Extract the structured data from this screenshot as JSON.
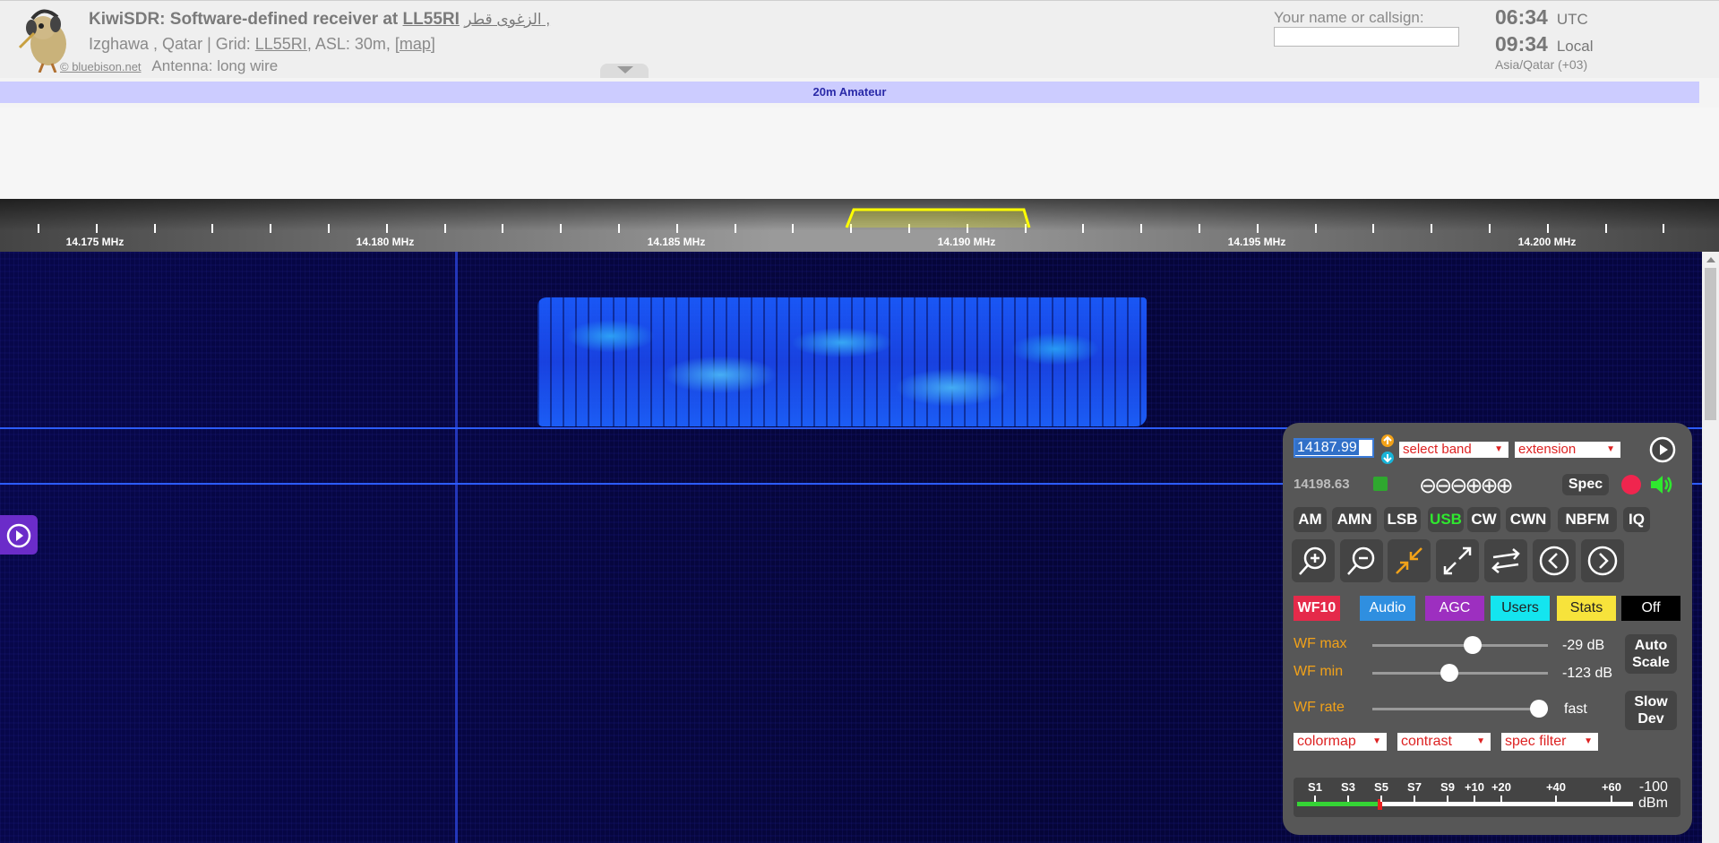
{
  "header": {
    "title_prefix": "KiwiSDR: Software-defined receiver at",
    "title_callsign": "LL55RI",
    "title_arabic": "الزغوى قطر ,",
    "location": "Izghawa , Qatar | Grid:",
    "grid": "LL55RI",
    "asl": ", ASL: 30m, [",
    "map_link": "map",
    "map_close": "]",
    "credit": "© bluebison.net",
    "antenna": "Antenna: long wire",
    "callsign_label": "Your name or callsign:",
    "callsign_value": "",
    "utc_time": "06:34",
    "utc_label": "UTC",
    "local_time": "09:34",
    "local_label": "Local",
    "timezone": "Asia/Qatar (+03)"
  },
  "band_bar": {
    "label": "20m Amateur"
  },
  "scale": {
    "labels": [
      "14.175 MHz",
      "14.180 MHz",
      "14.185 MHz",
      "14.190 MHz",
      "14.195 MHz",
      "14.200 MHz"
    ]
  },
  "panel": {
    "freq_value": "14187.99",
    "band_select": "select band",
    "extension_select": "extension",
    "freq_readout": "14198.63",
    "zoom_steps": "⊖⊖⊖⊕⊕⊕",
    "spec_label": "Spec",
    "modes": [
      "AM",
      "AMN",
      "LSB",
      "USB",
      "CW",
      "CWN",
      "NBFM",
      "IQ"
    ],
    "active_mode": "USB",
    "tabs": {
      "wf": "WF10",
      "audio": "Audio",
      "agc": "AGC",
      "users": "Users",
      "stats": "Stats",
      "off": "Off"
    },
    "wf_max": {
      "label": "WF max",
      "value": "-29 dB",
      "level": 0.58
    },
    "wf_min": {
      "label": "WF min",
      "value": "-123 dB",
      "level": 0.43
    },
    "wf_rate": {
      "label": "WF rate",
      "value": "fast",
      "level": 1.0
    },
    "auto_scale": "Auto\nScale",
    "slow_dev": "Slow\nDev",
    "colormap_select": "colormap",
    "contrast_select": "contrast",
    "spec_filter_select": "spec filter",
    "smeter": {
      "labels": [
        "S1",
        "S3",
        "S5",
        "S7",
        "S9",
        "+10",
        "+20",
        "+40",
        "+60"
      ],
      "dbm_value": "-100",
      "dbm_unit": "dBm"
    }
  },
  "colors": {
    "band_bar": "#ccccff",
    "waterfall_bg": "#06063f",
    "panel_bg": "#575757",
    "accent_orange": "#f2a219",
    "active_mode": "#2fe82f"
  }
}
